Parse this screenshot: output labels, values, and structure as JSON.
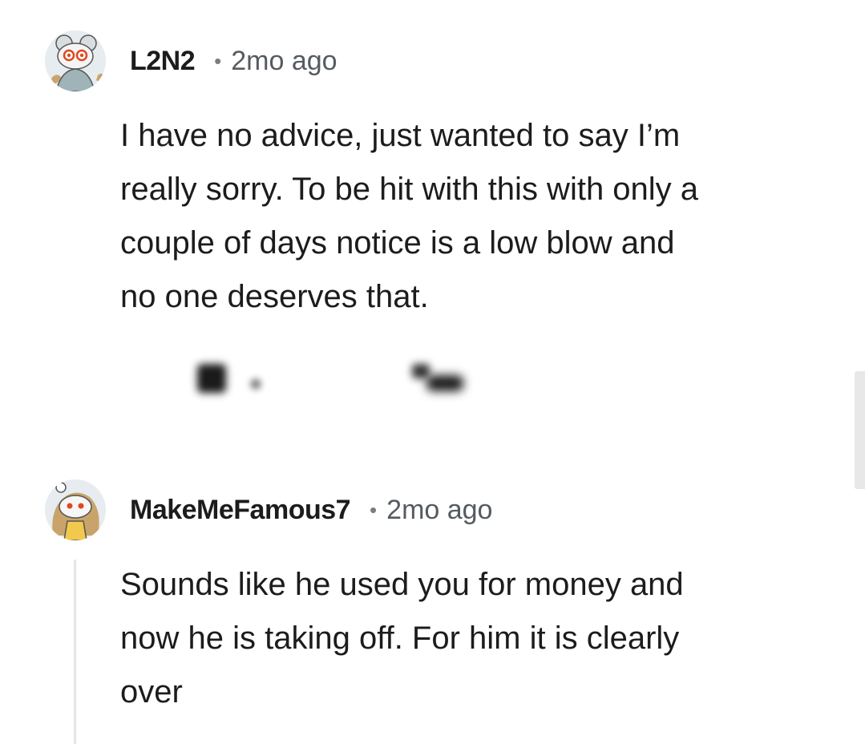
{
  "comments": [
    {
      "username": "L2N2",
      "separator": "•",
      "time": "2mo ago",
      "avatar_icon": "snoo-avatar-icon",
      "body_lines": [
        "I have no advice, just wanted to say I’m",
        "really sorry. To be hit with this with only a",
        "couple of days notice is a low blow and",
        "no one deserves that."
      ]
    },
    {
      "username": "MakeMeFamous7",
      "separator": "•",
      "time": "2mo ago",
      "avatar_icon": "snoo-avatar-icon",
      "body_lines": [
        "Sounds like he used you for money and",
        "now he is taking off. For him it is clearly",
        "over"
      ]
    }
  ],
  "colors": {
    "background": "#ffffff",
    "text": "#1c1c1c",
    "meta": "#555b60",
    "thread_line": "#e4e6e8"
  }
}
